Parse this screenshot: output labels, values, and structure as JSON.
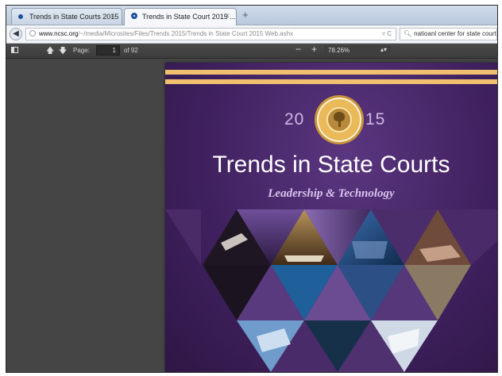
{
  "browser": {
    "tabs": [
      {
        "label": "Trends in State Courts 2015",
        "active": false
      },
      {
        "label": "Trends in State Court 2015 ...",
        "active": true
      }
    ],
    "new_tab_glyph": "+",
    "close_glyph": "×",
    "url_host": "www.ncsc.org",
    "url_path": "/~/media/Microsites/Files/Trends 2015/Trends in State Court 2015 Web.ashx",
    "url_tools": "▿ C",
    "search_value": "natioanl center for state courts"
  },
  "pdf_toolbar": {
    "page_label": "Page:",
    "page_value": "1",
    "page_of": "of 92",
    "zoom_out": "−",
    "zoom_in": "+",
    "zoom_value": "78.26%"
  },
  "document": {
    "year_left": "20",
    "year_right": "15",
    "title": "Trends in State Courts",
    "subtitle": "Leadership & Technology",
    "accent_color": "#f0c070",
    "cover_color": "#3a1e57"
  }
}
